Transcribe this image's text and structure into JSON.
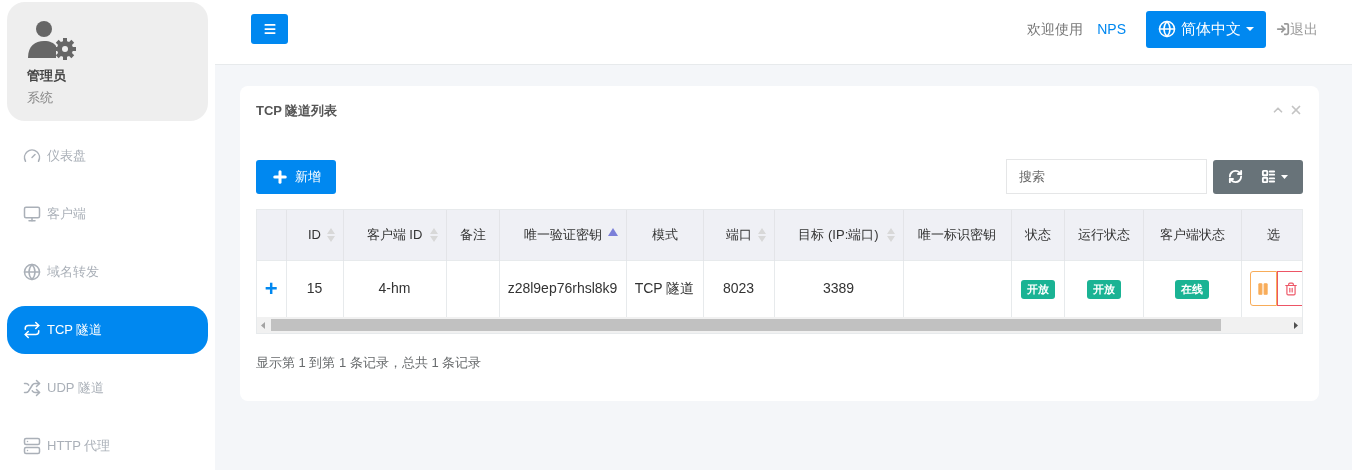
{
  "user": {
    "name": "管理员",
    "role": "系统"
  },
  "sidebar": {
    "items": [
      {
        "label": "仪表盘",
        "selected": false
      },
      {
        "label": "客户端",
        "selected": false
      },
      {
        "label": "域名转发",
        "selected": false
      },
      {
        "label": "TCP 隧道",
        "selected": true
      },
      {
        "label": "UDP 隧道",
        "selected": false
      },
      {
        "label": "HTTP 代理",
        "selected": false
      }
    ]
  },
  "header": {
    "welcome": "欢迎使用",
    "brand": "NPS",
    "language": "简体中文",
    "logout": "退出"
  },
  "panel": {
    "title": "TCP 隧道列表",
    "add_button": "新增",
    "search": {
      "placeholder": "搜索"
    },
    "table": {
      "columns": [
        {
          "label": "ID",
          "kind": "sortable"
        },
        {
          "label": "客户端 ID",
          "kind": "sortable"
        },
        {
          "label": "备注",
          "kind": "plain"
        },
        {
          "label": "唯一验证密钥",
          "kind": "ascending"
        },
        {
          "label": "模式",
          "kind": "plain"
        },
        {
          "label": "端口",
          "kind": "sortable"
        },
        {
          "label": "目标 (IP:端口)",
          "kind": "sortable"
        },
        {
          "label": "唯一标识密钥",
          "kind": "plain"
        },
        {
          "label": "状态",
          "kind": "plain"
        },
        {
          "label": "运行状态",
          "kind": "plain"
        },
        {
          "label": "客户端状态",
          "kind": "plain"
        },
        {
          "label": "选",
          "kind": "plain"
        }
      ],
      "rows": [
        {
          "expand": "+",
          "id": "15",
          "client_id": "4-hm",
          "verify_key": "z28l9ep76rhsl8k9",
          "mode": "TCP 隧道",
          "port": "8023",
          "target": "3389",
          "status": "开放",
          "run_status": "开放",
          "client_status": "在线"
        }
      ]
    },
    "footer": "显示第 1 到第 1 条记录，总共 1 条记录"
  }
}
